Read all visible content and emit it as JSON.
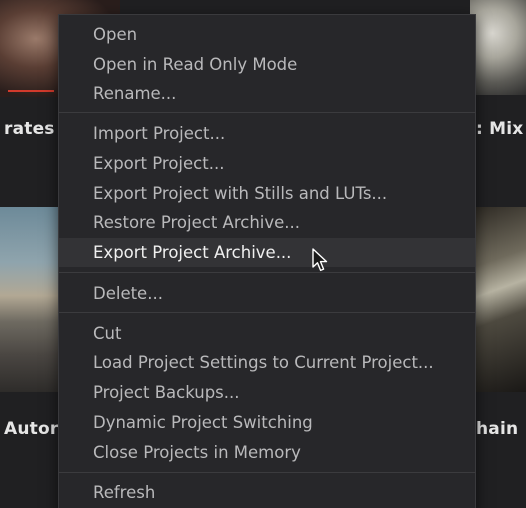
{
  "background": {
    "labels": {
      "top_left": "rates",
      "top_right": ": Mix",
      "bottom_left": "Autor",
      "bottom_right": "hain"
    }
  },
  "menu": {
    "items": [
      {
        "label": "Open",
        "state": "normal"
      },
      {
        "label": "Open in Read Only Mode",
        "state": "normal"
      },
      {
        "label": "Rename...",
        "state": "normal"
      },
      {
        "label": "Import Project...",
        "state": "normal"
      },
      {
        "label": "Export Project...",
        "state": "normal"
      },
      {
        "label": "Export Project with Stills and LUTs...",
        "state": "normal"
      },
      {
        "label": "Restore Project Archive...",
        "state": "normal"
      },
      {
        "label": "Export Project Archive...",
        "state": "hover"
      },
      {
        "label": "Delete...",
        "state": "normal"
      },
      {
        "label": "Cut",
        "state": "normal"
      },
      {
        "label": "Load Project Settings to Current Project...",
        "state": "normal"
      },
      {
        "label": "Project Backups...",
        "state": "normal"
      },
      {
        "label": "Dynamic Project Switching",
        "state": "normal"
      },
      {
        "label": "Close Projects in Memory",
        "state": "normal"
      },
      {
        "label": "Refresh",
        "state": "normal"
      }
    ]
  },
  "colors": {
    "menu_background": "#27272a",
    "menu_text": "#b9b9bb",
    "hover_background": "#333336",
    "hover_text": "#f0f0f0",
    "separator": "#3b3b3e"
  },
  "cursor": {
    "icon": "arrow-pointer-icon"
  }
}
